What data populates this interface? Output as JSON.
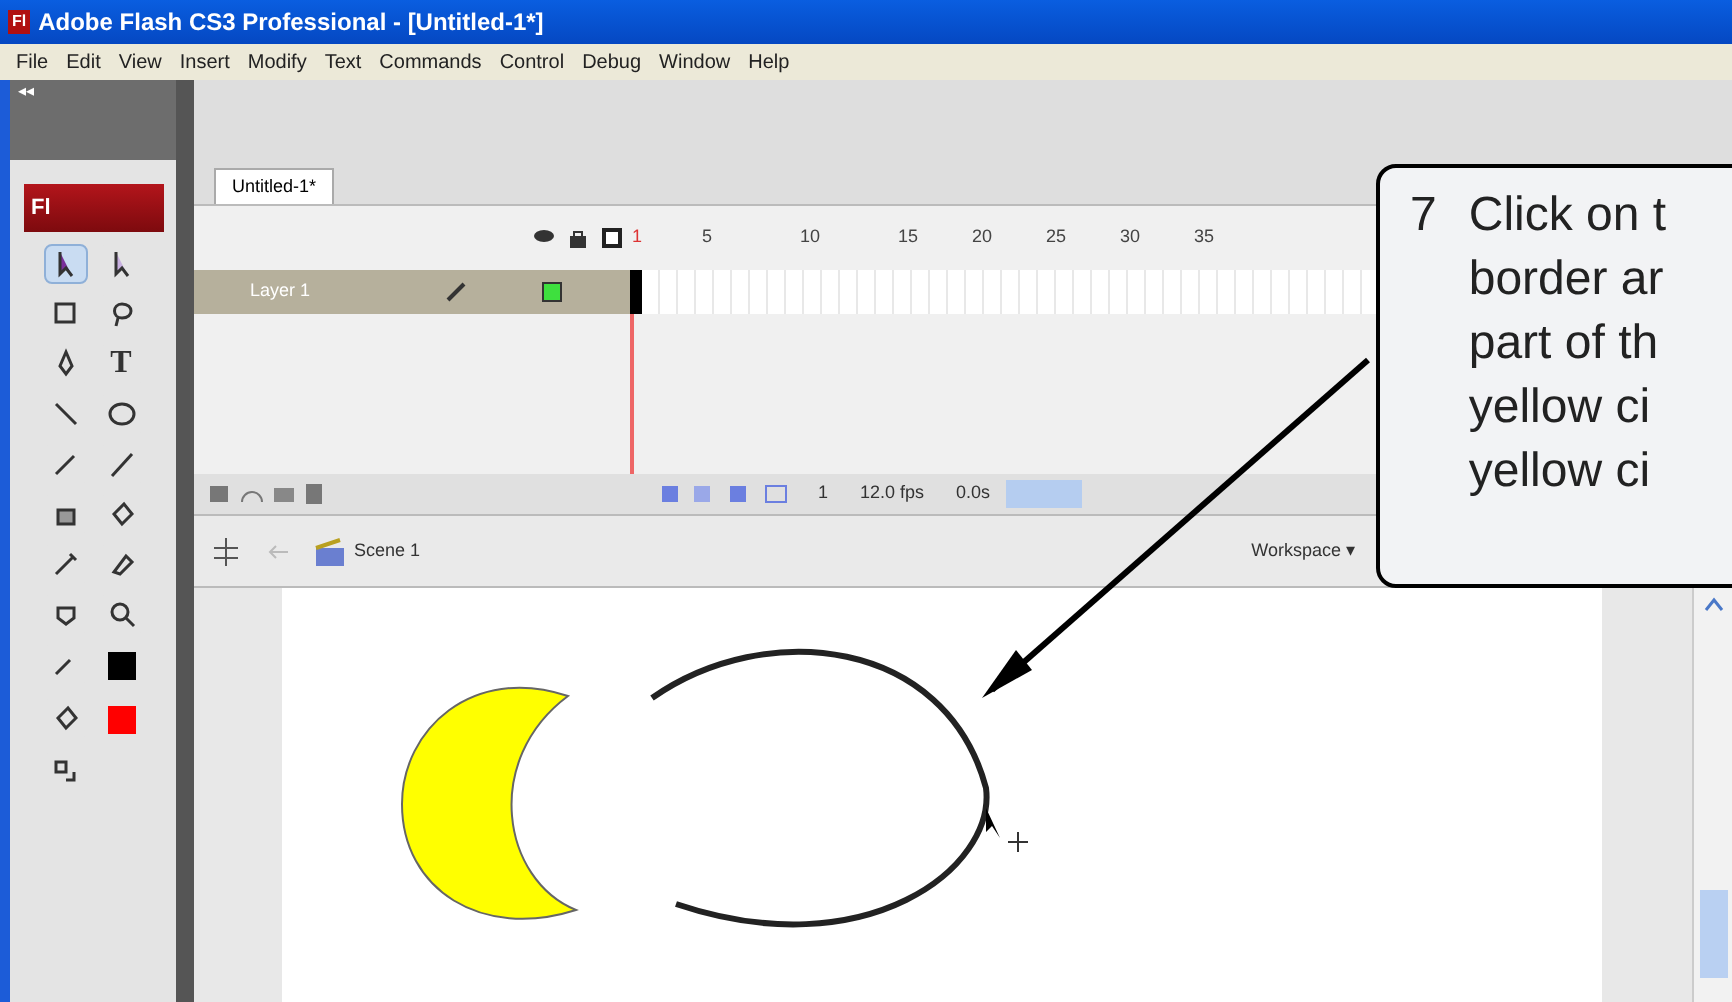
{
  "window": {
    "title": "Adobe Flash CS3 Professional - [Untitled-1*]",
    "app_badge": "Fl"
  },
  "menu": [
    "File",
    "Edit",
    "View",
    "Insert",
    "Modify",
    "Text",
    "Commands",
    "Control",
    "Debug",
    "Window",
    "Help"
  ],
  "toolbar": {
    "collapse": "◂◂",
    "logo": "Fl",
    "text_tool": "T",
    "selection_tools": [
      {
        "selected": true
      },
      {
        "selected": false
      }
    ]
  },
  "document_tab": {
    "label": "Untitled-1*",
    "selected": true
  },
  "timeline": {
    "frame_numbers": [
      "1",
      "5",
      "10",
      "15",
      "20",
      "25",
      "30",
      "35"
    ],
    "layers": [
      {
        "name": "Layer 1",
        "selected": true
      }
    ],
    "current_frame": "1",
    "frame_rate": "12.0 fps",
    "elapsed": "0.0s"
  },
  "scene_bar": {
    "scene": "Scene 1",
    "workspace": "Workspace ▾"
  },
  "callout": {
    "number": "7",
    "lines": [
      "Click on t",
      "border ar",
      "part of th",
      "yellow ci",
      "yellow ci"
    ]
  }
}
